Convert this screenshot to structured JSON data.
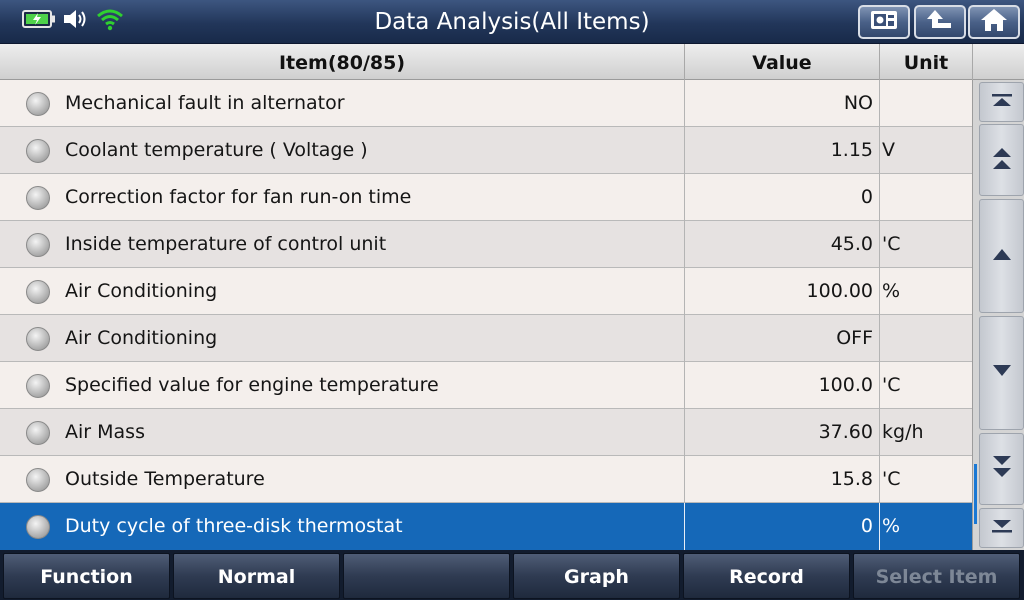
{
  "header": {
    "title": "Data Analysis(All Items)",
    "status_icons": [
      "battery-charging-icon",
      "speaker-icon",
      "wifi-icon"
    ],
    "buttons": [
      "screenshot-icon",
      "back-icon",
      "home-icon"
    ]
  },
  "table": {
    "columns": {
      "item": "Item(80/85)",
      "value": "Value",
      "unit": "Unit"
    },
    "rows": [
      {
        "name": "Mechanical fault in alternator",
        "value": "NO",
        "unit": ""
      },
      {
        "name": "Coolant temperature ( Voltage )",
        "value": "1.15",
        "unit": "V"
      },
      {
        "name": "Correction factor for fan run-on time",
        "value": "0",
        "unit": ""
      },
      {
        "name": "Inside temperature of control unit",
        "value": "45.0",
        "unit": "'C"
      },
      {
        "name": "Air Conditioning",
        "value": "100.00",
        "unit": "%"
      },
      {
        "name": "Air Conditioning",
        "value": "OFF",
        "unit": ""
      },
      {
        "name": "Specified value for engine temperature",
        "value": "100.0",
        "unit": "'C"
      },
      {
        "name": "Air Mass",
        "value": "37.60",
        "unit": "kg/h"
      },
      {
        "name": "Outside Temperature",
        "value": "15.8",
        "unit": "'C"
      },
      {
        "name": "Duty cycle of three-disk thermostat",
        "value": "0",
        "unit": "%"
      }
    ],
    "selected_index": 9
  },
  "scroll_buttons": [
    "scroll-top-icon",
    "page-up-icon",
    "line-up-icon",
    "line-down-icon",
    "page-down-icon",
    "scroll-bottom-icon"
  ],
  "footer": {
    "function": "Function",
    "normal": "Normal",
    "empty": "",
    "graph": "Graph",
    "record": "Record",
    "select_item": "Select Item"
  },
  "colors": {
    "selected_row": "#1568b8",
    "title_bar": "#22365a",
    "wifi": "#2fd02f",
    "battery": "#4ed14a"
  }
}
